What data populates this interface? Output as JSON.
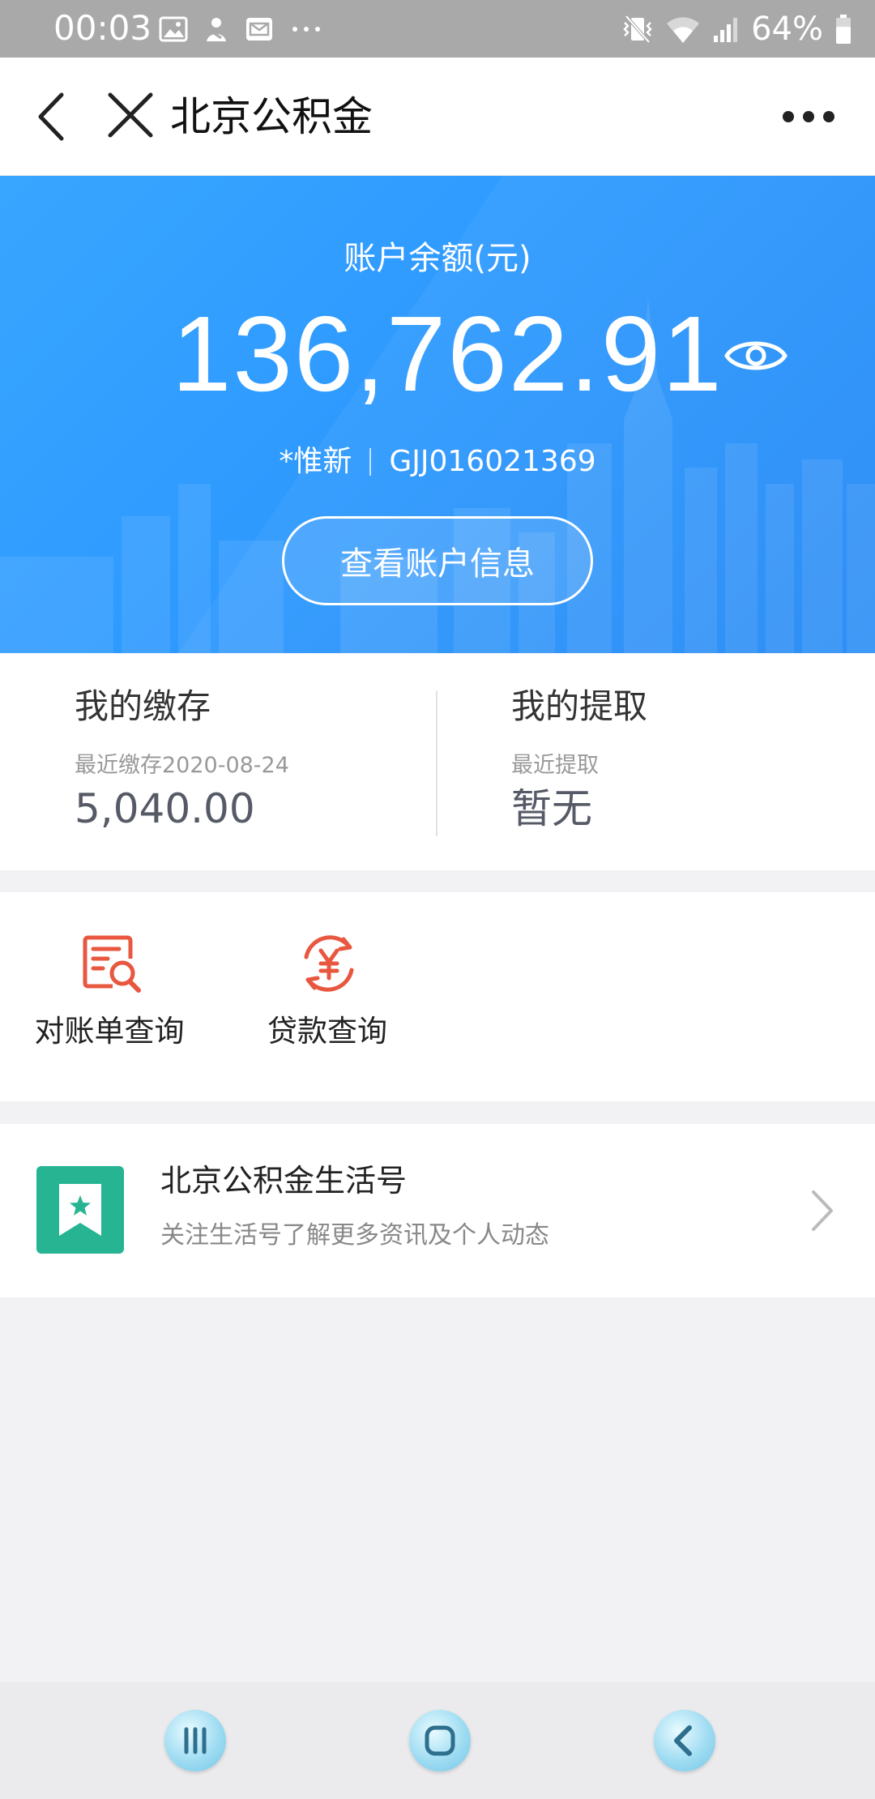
{
  "status_bar": {
    "time": "00:03",
    "battery_percent": "64%",
    "icons_left": [
      "gallery-icon",
      "app-notification-icon",
      "mail-icon",
      "more-notifications-icon"
    ],
    "icons_right": [
      "vibrate-icon",
      "wifi-icon",
      "signal-icon",
      "battery-icon"
    ]
  },
  "title_bar": {
    "title": "北京公积金"
  },
  "account": {
    "balance_label": "账户余额(元)",
    "balance": "136,762.91",
    "holder_name": "*惟新",
    "account_no": "GJJ016021369",
    "view_info_button": "查看账户信息"
  },
  "stats": {
    "deposit": {
      "title": "我的缴存",
      "subtitle": "最近缴存2020-08-24",
      "value": "5,040.00"
    },
    "withdraw": {
      "title": "我的提取",
      "subtitle": "最近提取",
      "value": "暂无"
    }
  },
  "services": [
    {
      "label": "对账单查询",
      "icon": "statement-search-icon"
    },
    {
      "label": "贷款查询",
      "icon": "loan-yuan-icon"
    }
  ],
  "life_account": {
    "title": "北京公积金生活号",
    "description": "关注生活号了解更多资讯及个人动态"
  },
  "colors": {
    "hero_blue": "#2f9bff",
    "service_icon_red": "#e8573f",
    "life_logo_green": "#26b492"
  }
}
